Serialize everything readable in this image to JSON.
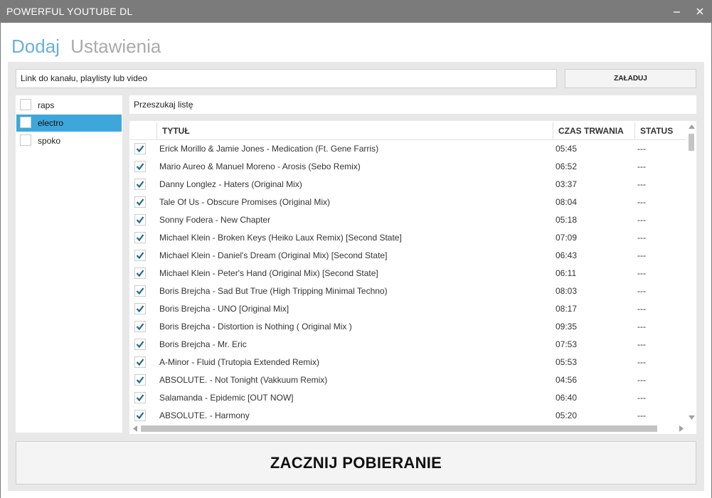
{
  "window": {
    "title": "POWERFUL YOUTUBE DL"
  },
  "tabs": {
    "active": "Dodaj",
    "inactive": "Ustawienia"
  },
  "url_input": {
    "value": "Link do kanału, playlisty lub video"
  },
  "load_button": {
    "label": "ZAŁADUJ"
  },
  "sidebar": {
    "items": [
      {
        "label": "raps",
        "selected": false
      },
      {
        "label": "electro",
        "selected": true
      },
      {
        "label": "spoko",
        "selected": false
      }
    ]
  },
  "search": {
    "value": "Przeszukaj listę"
  },
  "table": {
    "columns": {
      "title": "TYTUŁ",
      "duration": "CZAS TRWANIA",
      "status": "STATUS"
    },
    "rows": [
      {
        "checked": true,
        "title": "Erick Morillo & Jamie Jones - Medication (Ft. Gene Farris)",
        "duration": "05:45",
        "status": "---"
      },
      {
        "checked": true,
        "title": "Mario Aureo & Manuel Moreno - Arosis (Sebo Remix)",
        "duration": "06:52",
        "status": "---"
      },
      {
        "checked": true,
        "title": "Danny Longlez - Haters (Original Mix)",
        "duration": "03:37",
        "status": "---"
      },
      {
        "checked": true,
        "title": "Tale Of Us - Obscure Promises (Original Mix)",
        "duration": "08:04",
        "status": "---"
      },
      {
        "checked": true,
        "title": "Sonny Fodera - New Chapter",
        "duration": "05:18",
        "status": "---"
      },
      {
        "checked": true,
        "title": "Michael Klein - Broken Keys (Heiko Laux Remix) [Second State]",
        "duration": "07:09",
        "status": "---"
      },
      {
        "checked": true,
        "title": "Michael Klein - Daniel's Dream (Original Mix) [Second State]",
        "duration": "06:43",
        "status": "---"
      },
      {
        "checked": true,
        "title": "Michael Klein - Peter's Hand (Original Mix) [Second State]",
        "duration": "06:11",
        "status": "---"
      },
      {
        "checked": true,
        "title": "Boris Brejcha - Sad But True (High Tripping Minimal Techno)",
        "duration": "08:03",
        "status": "---"
      },
      {
        "checked": true,
        "title": "Boris Brejcha - UNO [Original Mix]",
        "duration": "08:17",
        "status": "---"
      },
      {
        "checked": true,
        "title": "Boris Brejcha - Distortion is Nothing ( Original Mix )",
        "duration": "09:35",
        "status": "---"
      },
      {
        "checked": true,
        "title": "Boris Brejcha - Mr. Eric",
        "duration": "07:53",
        "status": "---"
      },
      {
        "checked": true,
        "title": "A-Minor - Fluid (Trutopia Extended Remix)",
        "duration": "05:53",
        "status": "---"
      },
      {
        "checked": true,
        "title": "ABSOLUTE. - Not Tonight (Vakkuum Remix)",
        "duration": "04:56",
        "status": "---"
      },
      {
        "checked": true,
        "title": "Salamanda - Epidemic [OUT NOW]",
        "duration": "06:40",
        "status": "---"
      },
      {
        "checked": true,
        "title": "ABSOLUTE. - Harmony",
        "duration": "05:20",
        "status": "---"
      }
    ]
  },
  "start_button": {
    "label": "ZACZNIJ POBIERANIE"
  },
  "colors": {
    "titlebar": "#7b7b7b",
    "accent": "#3da7db",
    "tab_active": "#6ab0da",
    "tab_inactive": "#aaaaaa",
    "check": "#1f6a8f"
  },
  "icons": {
    "minimize": "minimize-icon",
    "close": "close-icon",
    "check": "checkmark-icon",
    "scroll_up": "arrow-up-icon",
    "scroll_down": "arrow-down-icon",
    "scroll_left": "arrow-left-icon",
    "scroll_right": "arrow-right-icon"
  }
}
